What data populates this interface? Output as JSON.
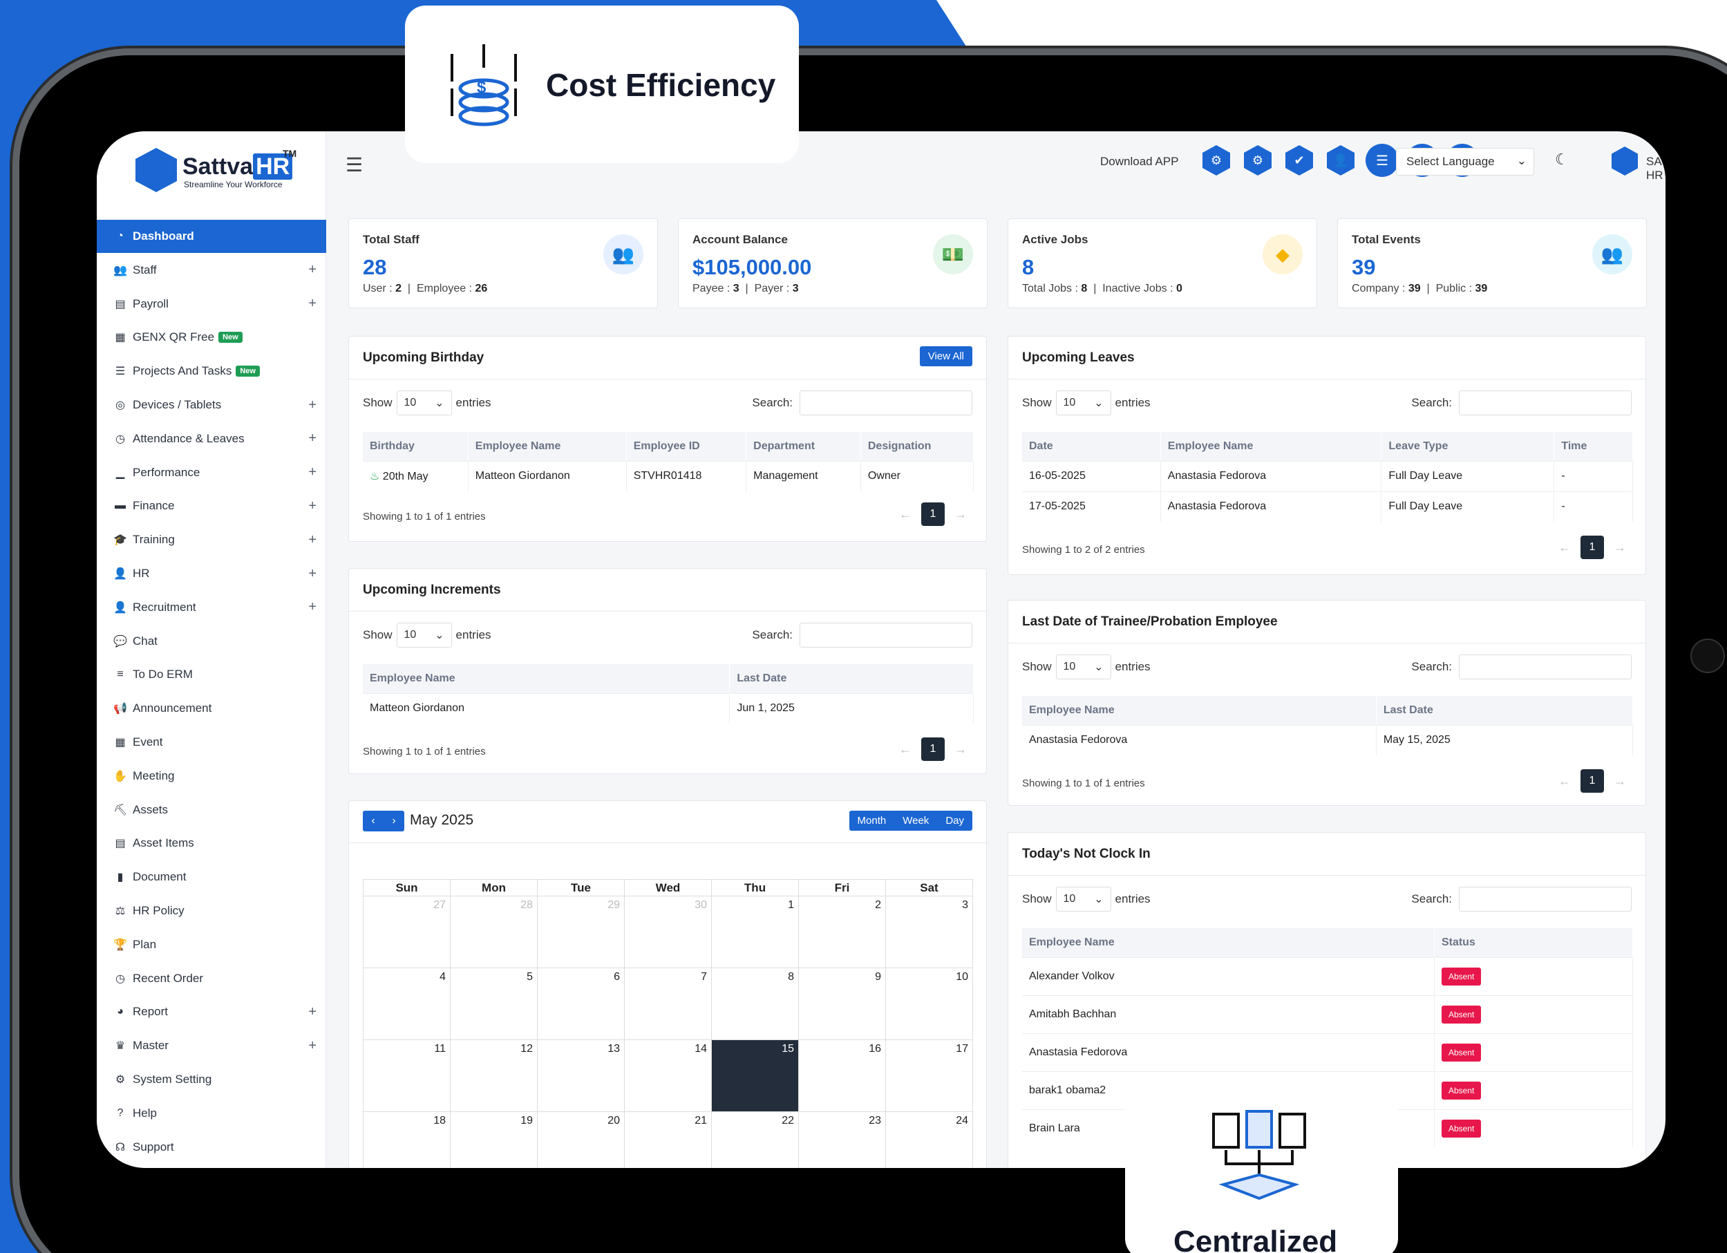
{
  "promo": {
    "top_label": "Cost Efficiency",
    "bottom_label": "Centralized"
  },
  "brand": {
    "name": "Sattva",
    "name_hr": "HR",
    "trademark": "TM",
    "tagline": "Streamline Your Workforce",
    "accent": "#1b66d2"
  },
  "topbar": {
    "download_label": "Download APP",
    "language_placeholder": "Select Language",
    "user_name": "SATTVA HR"
  },
  "sidebar": {
    "items": [
      {
        "label": "Dashboard",
        "icon": "speedometer-icon"
      },
      {
        "label": "Staff",
        "icon": "users-icon"
      },
      {
        "label": "Payroll",
        "icon": "document-icon"
      },
      {
        "label": "GENX QR Free",
        "icon": "qr-icon",
        "badge": "New"
      },
      {
        "label": "Projects And Tasks",
        "icon": "tasks-icon",
        "badge": "New"
      },
      {
        "label": "Devices / Tablets",
        "icon": "fingerprint-icon"
      },
      {
        "label": "Attendance & Leaves",
        "icon": "clock-icon"
      },
      {
        "label": "Performance",
        "icon": "chart-icon"
      },
      {
        "label": "Finance",
        "icon": "wallet-icon"
      },
      {
        "label": "Training",
        "icon": "graduation-icon"
      },
      {
        "label": "HR",
        "icon": "user-gear-icon"
      },
      {
        "label": "Recruitment",
        "icon": "user-tie-icon"
      },
      {
        "label": "Chat",
        "icon": "chat-icon"
      },
      {
        "label": "To Do ERM",
        "icon": "list-icon"
      },
      {
        "label": "Announcement",
        "icon": "megaphone-icon"
      },
      {
        "label": "Event",
        "icon": "calendar-icon"
      },
      {
        "label": "Meeting",
        "icon": "handshake-icon"
      },
      {
        "label": "Assets",
        "icon": "assets-icon"
      },
      {
        "label": "Asset Items",
        "icon": "items-icon"
      },
      {
        "label": "Document",
        "icon": "file-icon"
      },
      {
        "label": "HR Policy",
        "icon": "policy-icon"
      },
      {
        "label": "Plan",
        "icon": "trophy-icon"
      },
      {
        "label": "Recent Order",
        "icon": "clock-icon"
      },
      {
        "label": "Report",
        "icon": "pie-icon"
      },
      {
        "label": "Master",
        "icon": "crown-icon"
      },
      {
        "label": "System Setting",
        "icon": "gear-icon"
      },
      {
        "label": "Help",
        "icon": "help-icon"
      },
      {
        "label": "Support",
        "icon": "headset-icon"
      }
    ]
  },
  "stats": [
    {
      "title": "Total Staff",
      "value": "28",
      "l1": "User :",
      "v1": "2",
      "l2": "Employee :",
      "v2": "26",
      "icon": "users-icon",
      "icon_bg": "#e5efff",
      "icon_color": "#1b66d2"
    },
    {
      "title": "Account Balance",
      "value": "$105,000.00",
      "l1": "Payee :",
      "v1": "3",
      "l2": "Payer :",
      "v2": "3",
      "icon": "money-icon",
      "icon_bg": "#e4f5ea",
      "icon_color": "#1f9d55"
    },
    {
      "title": "Active Jobs",
      "value": "8",
      "l1": "Total Jobs :",
      "v1": "8",
      "l2": "Inactive Jobs :",
      "v2": "0",
      "icon": "tag-icon",
      "icon_bg": "#fff4d6",
      "icon_color": "#f5b400"
    },
    {
      "title": "Total Events",
      "value": "39",
      "l1": "Company :",
      "v1": "39",
      "l2": "Public :",
      "v2": "39",
      "icon": "users-icon",
      "icon_bg": "#dff5fb",
      "icon_color": "#27b1d8"
    }
  ],
  "common": {
    "show": "Show",
    "entries": "entries",
    "search": "Search:",
    "page_size": "10",
    "page": "1"
  },
  "birthday": {
    "title": "Upcoming Birthday",
    "view_all": "View All",
    "columns": [
      "Birthday",
      "Employee Name",
      "Employee ID",
      "Department",
      "Designation"
    ],
    "rows": [
      [
        "20th May",
        "Matteon Giordanon",
        "STVHR01418",
        "Management",
        "Owner"
      ]
    ],
    "showing": "Showing 1 to 1 of 1 entries"
  },
  "increments": {
    "title": "Upcoming Increments",
    "columns": [
      "Employee Name",
      "Last Date"
    ],
    "rows": [
      [
        "Matteon Giordanon",
        "Jun 1, 2025"
      ]
    ],
    "showing": "Showing 1 to 1 of 1 entries"
  },
  "leaves": {
    "title": "Upcoming Leaves",
    "columns": [
      "Date",
      "Employee Name",
      "Leave Type",
      "Time"
    ],
    "rows": [
      [
        "16-05-2025",
        "Anastasia Fedorova",
        "Full Day Leave",
        "-"
      ],
      [
        "17-05-2025",
        "Anastasia Fedorova",
        "Full Day Leave",
        "-"
      ]
    ],
    "showing": "Showing 1 to 2 of 2 entries"
  },
  "trainee": {
    "title": "Last Date of Trainee/Probation Employee",
    "columns": [
      "Employee Name",
      "Last Date"
    ],
    "rows": [
      [
        "Anastasia Fedorova",
        "May 15, 2025"
      ]
    ],
    "showing": "Showing 1 to 1 of 1 entries"
  },
  "not_clock_in": {
    "title": "Today's Not Clock In",
    "columns": [
      "Employee Name",
      "Status"
    ],
    "rows": [
      [
        "Alexander Volkov",
        "Absent"
      ],
      [
        "Amitabh Bachhan",
        "Absent"
      ],
      [
        "Anastasia Fedorova",
        "Absent"
      ],
      [
        "barak1 obama2",
        "Absent"
      ],
      [
        "Brain Lara",
        "Absent"
      ]
    ],
    "status_color": "#e8174b"
  },
  "calendar": {
    "title": "May 2025",
    "views": [
      "Month",
      "Week",
      "Day"
    ],
    "days": [
      "Sun",
      "Mon",
      "Tue",
      "Wed",
      "Thu",
      "Fri",
      "Sat"
    ],
    "weeks": [
      [
        "27",
        "28",
        "29",
        "30",
        "1",
        "2",
        "3"
      ],
      [
        "4",
        "5",
        "6",
        "7",
        "8",
        "9",
        "10"
      ],
      [
        "11",
        "12",
        "13",
        "14",
        "15",
        "16",
        "17"
      ],
      [
        "18",
        "19",
        "20",
        "21",
        "22",
        "23",
        "24"
      ]
    ],
    "today": "15"
  }
}
